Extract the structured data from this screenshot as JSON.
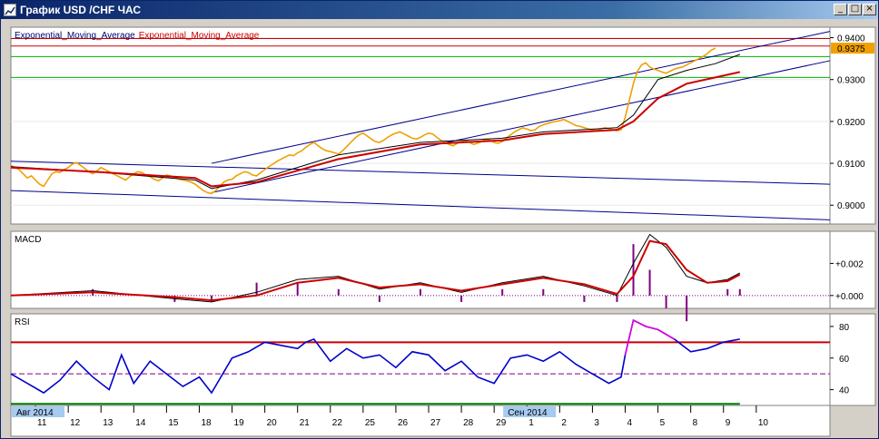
{
  "window": {
    "title": "График USD /CHF  ЧАС",
    "buttons": {
      "minimize": "_",
      "maximize": "□",
      "close": "×"
    }
  },
  "chart_data": {
    "type": "line",
    "panels": [
      {
        "id": "price",
        "legend": [
          "Exponential_Moving_Average",
          "Exponential_Moving_Average"
        ],
        "legend_colors": [
          "#00006a",
          "#cc0000"
        ],
        "ylim": [
          0.8955,
          0.9425
        ],
        "yticks": [
          0.9,
          0.91,
          0.92,
          0.93,
          0.94
        ],
        "ytick_labels": [
          "0.9000",
          "0.9100",
          "0.9200",
          "0.9300",
          "0.9400"
        ],
        "current_price": 0.9375,
        "current_price_label": "0.9375",
        "colors": {
          "price": "#f0a000",
          "ema_fast": "#000000",
          "ema_slow": "#cc0000",
          "trendline": "#00008b",
          "resistance": "#cc0000",
          "support": "#00b000",
          "label_bg": "#f0a000"
        },
        "series": [
          {
            "name": "price",
            "x": [
              0,
              1,
              2,
              3,
              4,
              5,
              6,
              7,
              8,
              9,
              10,
              11,
              12,
              13,
              14,
              15,
              16,
              17,
              18,
              19,
              20,
              21,
              22,
              23,
              24,
              25,
              26,
              27,
              28,
              29,
              30,
              31,
              32,
              33,
              34,
              35,
              36,
              37,
              38,
              39,
              40,
              41,
              42,
              43,
              44,
              45,
              46,
              47,
              48,
              49,
              50,
              51,
              52,
              53,
              54,
              55,
              56,
              57,
              58,
              59,
              60,
              61,
              62,
              63,
              64,
              65,
              66,
              67,
              68,
              69,
              70,
              71,
              72,
              73,
              74,
              75,
              76,
              77,
              78,
              79,
              80,
              81,
              82,
              83,
              84,
              85,
              86,
              87,
              88,
              89,
              90,
              91,
              92,
              93,
              94,
              95,
              96,
              97,
              98,
              99,
              100,
              101,
              102,
              103,
              104,
              105,
              106,
              107,
              108,
              109,
              110,
              111,
              112,
              113,
              114,
              115,
              116,
              117,
              118,
              119,
              120,
              121,
              122,
              123,
              124,
              125,
              126,
              127,
              128,
              129,
              130,
              131,
              132,
              133,
              134,
              135,
              136,
              137,
              138,
              139,
              140,
              141,
              142,
              143,
              144,
              145,
              146,
              147,
              148,
              149,
              150,
              151,
              152,
              153,
              154,
              155,
              156,
              157,
              158,
              159,
              160,
              161,
              162,
              163,
              164,
              165,
              166,
              167,
              168,
              169,
              170,
              171,
              172,
              173,
              174,
              175,
              176,
              177,
              178,
              179,
              180,
              181,
              182,
              183,
              184,
              185,
              186,
              187,
              188,
              189,
              190,
              191,
              192,
              193,
              194,
              195,
              196,
              197,
              198,
              199,
              200,
              201,
              202,
              203,
              204,
              205,
              206,
              207,
              208,
              209,
              210,
              211,
              212,
              213,
              214,
              215,
              216,
              217,
              218,
              219,
              220,
              221,
              222,
              223,
              224,
              225,
              226,
              227,
              228,
              229,
              230,
              231,
              232,
              233,
              234,
              235,
              236,
              237,
              238,
              239,
              240
            ],
            "y": [
              0.9095,
              0.909,
              0.9085,
              0.9075,
              0.9065,
              0.907,
              0.906,
              0.905,
              0.9045,
              0.906,
              0.9075,
              0.908,
              0.9078,
              0.9085,
              0.909,
              0.9098,
              0.9102,
              0.9095,
              0.9088,
              0.908,
              0.9075,
              0.9082,
              0.909,
              0.9085,
              0.908,
              0.9075,
              0.907,
              0.9065,
              0.906,
              0.9068,
              0.9075,
              0.908,
              0.9078,
              0.9072,
              0.9068,
              0.9062,
              0.9058,
              0.9065,
              0.9072,
              0.907,
              0.9066,
              0.9062,
              0.906,
              0.9058,
              0.9055,
              0.905,
              0.9042,
              0.9035,
              0.903,
              0.9028,
              0.9035,
              0.9045,
              0.9055,
              0.906,
              0.9062,
              0.907,
              0.9075,
              0.908,
              0.9078,
              0.9072,
              0.907,
              0.9078,
              0.9085,
              0.9092,
              0.9098,
              0.9105,
              0.911,
              0.9115,
              0.912,
              0.9118,
              0.9125,
              0.913,
              0.9138,
              0.9145,
              0.915,
              0.9142,
              0.9135,
              0.913,
              0.9128,
              0.9125,
              0.9122,
              0.913,
              0.914,
              0.915,
              0.916,
              0.9168,
              0.9172,
              0.9165,
              0.9158,
              0.9152,
              0.915,
              0.9155,
              0.9162,
              0.9168,
              0.9172,
              0.9175,
              0.917,
              0.9165,
              0.916,
              0.9158,
              0.9162,
              0.9168,
              0.9172,
              0.917,
              0.9162,
              0.9155,
              0.915,
              0.9145,
              0.9142,
              0.9148,
              0.9152,
              0.9155,
              0.915,
              0.9145,
              0.9148,
              0.9152,
              0.9158,
              0.9155,
              0.915,
              0.9148,
              0.9152,
              0.916,
              0.9168,
              0.9175,
              0.918,
              0.9185,
              0.9182,
              0.9178,
              0.918,
              0.9188,
              0.9192,
              0.9195,
              0.9198,
              0.92,
              0.9202,
              0.9205,
              0.92,
              0.9195,
              0.919,
              0.9188,
              0.9185,
              0.9182,
              0.918,
              0.9178,
              0.9182,
              0.9185,
              0.9183,
              0.918,
              0.9178,
              0.918,
              0.921,
              0.925,
              0.929,
              0.932,
              0.9335,
              0.934,
              0.933,
              0.9325,
              0.9322,
              0.9318,
              0.9315,
              0.932,
              0.9325,
              0.9328,
              0.933,
              0.9335,
              0.934,
              0.9345,
              0.935,
              0.9355,
              0.9362,
              0.937,
              0.9375
            ],
            "note_x_units": "hourly bar index"
          },
          {
            "name": "ema_fast",
            "x": [
              0,
              20,
              45,
              49,
              60,
              80,
              100,
              120,
              130,
              148,
              152,
              158,
              165,
              172,
              178
            ],
            "y": [
              0.9092,
              0.908,
              0.906,
              0.904,
              0.906,
              0.912,
              0.915,
              0.916,
              0.9175,
              0.9185,
              0.9215,
              0.93,
              0.9322,
              0.9338,
              0.936
            ]
          },
          {
            "name": "ema_slow",
            "x": [
              0,
              20,
              45,
              49,
              60,
              80,
              100,
              120,
              130,
              148,
              152,
              158,
              165,
              172,
              178
            ],
            "y": [
              0.909,
              0.908,
              0.9065,
              0.9045,
              0.9055,
              0.911,
              0.9145,
              0.9155,
              0.917,
              0.918,
              0.92,
              0.9255,
              0.929,
              0.9305,
              0.9318
            ]
          },
          {
            "name": "trendline_channel_top",
            "x": [
              49,
              240
            ],
            "y": [
              0.91,
              0.9415
            ]
          },
          {
            "name": "trendline_channel_bottom",
            "x": [
              49,
              240
            ],
            "y": [
              0.903,
              0.9345
            ]
          },
          {
            "name": "trendline_down_top",
            "x": [
              0,
              240
            ],
            "y": [
              0.9105,
              0.905
            ]
          },
          {
            "name": "trendline_down_bottom",
            "x": [
              0,
              240
            ],
            "y": [
              0.9035,
              0.8965
            ]
          },
          {
            "name": "resistance_1",
            "y": 0.9398
          },
          {
            "name": "resistance_2",
            "y": 0.938
          },
          {
            "name": "support_1",
            "y": 0.9355
          },
          {
            "name": "support_2",
            "y": 0.9305
          }
        ]
      },
      {
        "id": "macd",
        "legend": [
          "MACD"
        ],
        "ylim": [
          -0.0008,
          0.004
        ],
        "yticks": [
          0.0,
          0.002
        ],
        "ytick_labels": [
          "+0.000",
          "+0.002"
        ],
        "colors": {
          "macd": "#000000",
          "signal": "#cc0000",
          "histogram": "#800080"
        },
        "series": [
          {
            "name": "macd",
            "x": [
              0,
              20,
              40,
              49,
              60,
              70,
              80,
              90,
              100,
              110,
              120,
              130,
              140,
              148,
              152,
              156,
              160,
              165,
              170,
              175,
              178
            ],
            "y": [
              0.0,
              0.0003,
              -0.0002,
              -0.0004,
              0.0002,
              0.001,
              0.0012,
              0.0004,
              0.0008,
              0.0002,
              0.0008,
              0.0012,
              0.0006,
              0.0,
              0.002,
              0.0038,
              0.003,
              0.0012,
              0.0008,
              0.001,
              0.0014
            ]
          },
          {
            "name": "signal",
            "x": [
              0,
              20,
              40,
              49,
              60,
              70,
              80,
              90,
              100,
              110,
              120,
              130,
              140,
              148,
              152,
              156,
              160,
              165,
              170,
              175,
              178
            ],
            "y": [
              0.0,
              0.0002,
              -0.0001,
              -0.0003,
              0.0,
              0.0008,
              0.0011,
              0.0005,
              0.0007,
              0.0003,
              0.0007,
              0.0011,
              0.0007,
              0.0001,
              0.0012,
              0.0034,
              0.0032,
              0.0016,
              0.0008,
              0.0009,
              0.0013
            ]
          }
        ]
      },
      {
        "id": "rsi",
        "legend": [
          "RSI"
        ],
        "ylim": [
          30,
          88
        ],
        "yticks": [
          40,
          60,
          80
        ],
        "ytick_labels": [
          "40",
          "60",
          "80"
        ],
        "levels": [
          70,
          50,
          30
        ],
        "colors": {
          "rsi": "#0000cc",
          "overbought_segment": "#e000e0",
          "level70": "#cc0000",
          "level50": "#800080",
          "level30": "#008000"
        },
        "series": [
          {
            "name": "rsi",
            "x": [
              0,
              4,
              8,
              12,
              16,
              20,
              24,
              27,
              30,
              34,
              38,
              42,
              46,
              49,
              54,
              58,
              62,
              66,
              70,
              72,
              74,
              78,
              82,
              86,
              90,
              94,
              98,
              102,
              106,
              110,
              114,
              118,
              122,
              126,
              130,
              134,
              138,
              142,
              146,
              149,
              150,
              152,
              155,
              158,
              162,
              166,
              170,
              174,
              178
            ],
            "y": [
              50,
              44,
              38,
              46,
              58,
              48,
              40,
              62,
              44,
              58,
              50,
              42,
              48,
              38,
              60,
              64,
              70,
              68,
              66,
              70,
              72,
              58,
              66,
              60,
              62,
              54,
              64,
              62,
              52,
              58,
              48,
              44,
              60,
              62,
              58,
              64,
              56,
              50,
              44,
              48,
              62,
              84,
              80,
              78,
              72,
              64,
              66,
              70,
              72
            ]
          }
        ]
      }
    ],
    "x_axis": {
      "tick_labels": [
        "11",
        "12",
        "13",
        "14",
        "15",
        "18",
        "19",
        "20",
        "21",
        "22",
        "25",
        "26",
        "27",
        "28",
        "29",
        "1",
        "2",
        "3",
        "4",
        "5",
        "8",
        "9",
        "10"
      ],
      "tick_x": [
        6,
        14,
        22,
        30,
        38,
        46,
        54,
        62,
        70,
        78,
        86,
        94,
        102,
        110,
        118,
        126,
        134,
        142,
        150,
        158,
        166,
        174,
        182
      ],
      "month_labels": [
        "Авг 2014",
        "Сен 2014"
      ],
      "month_x": [
        0,
        120
      ]
    }
  }
}
